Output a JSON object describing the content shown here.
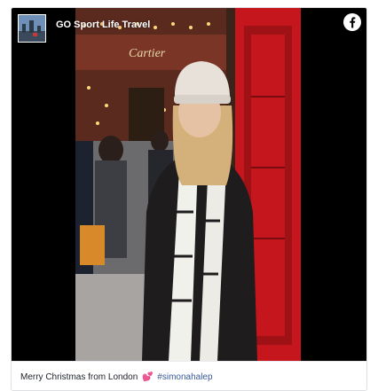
{
  "post": {
    "page_name": "GO Sport Life Travel",
    "caption_text": "Merry Christmas from London",
    "caption_emoji": "💕",
    "hashtag": "#simonahalep",
    "shop_sign_text": "Cartier",
    "platform_icon": "facebook-icon",
    "avatar_icon": "page-avatar-icon"
  },
  "colors": {
    "facebook_blue": "#1877f2",
    "hashtag_blue": "#385898",
    "phone_box_red": "#c4161c"
  }
}
